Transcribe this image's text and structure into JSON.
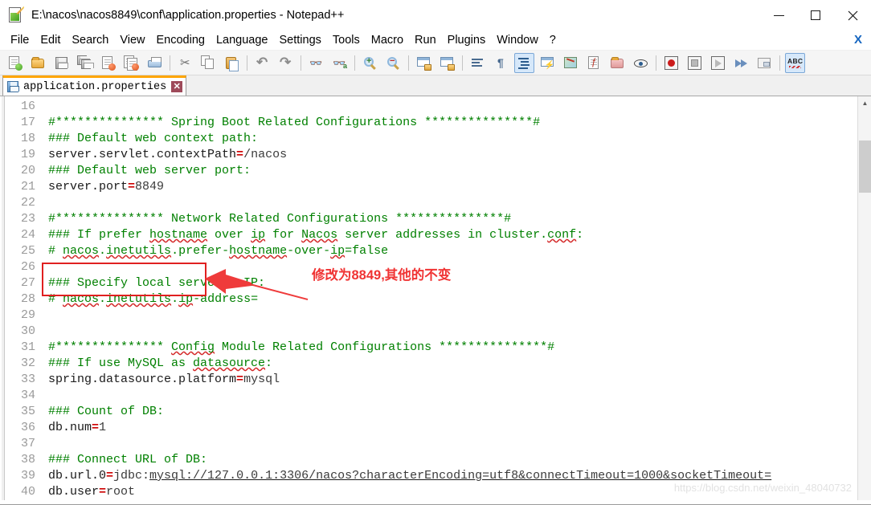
{
  "window": {
    "title": "E:\\nacos\\nacos8849\\conf\\application.properties - Notepad++",
    "icon": "notepad-plus-plus-icon",
    "minimize_label": "–",
    "maximize_label": "□",
    "close_label": "✕"
  },
  "menu": {
    "items": [
      {
        "label": "File"
      },
      {
        "label": "Edit"
      },
      {
        "label": "Search"
      },
      {
        "label": "View"
      },
      {
        "label": "Encoding"
      },
      {
        "label": "Language"
      },
      {
        "label": "Settings"
      },
      {
        "label": "Tools"
      },
      {
        "label": "Macro"
      },
      {
        "label": "Run"
      },
      {
        "label": "Plugins"
      },
      {
        "label": "Window"
      },
      {
        "label": "?"
      }
    ],
    "close_document_label": "X"
  },
  "toolbar": {
    "buttons": [
      {
        "name": "new-file-icon",
        "tooltip": "New"
      },
      {
        "name": "open-file-icon",
        "tooltip": "Open"
      },
      {
        "name": "save-icon",
        "tooltip": "Save"
      },
      {
        "name": "save-all-icon",
        "tooltip": "Save All"
      },
      {
        "name": "close-file-icon",
        "tooltip": "Close"
      },
      {
        "name": "close-all-files-icon",
        "tooltip": "Close All"
      },
      {
        "name": "print-icon",
        "tooltip": "Print"
      },
      {
        "name": "cut-icon",
        "tooltip": "Cut"
      },
      {
        "name": "copy-icon",
        "tooltip": "Copy"
      },
      {
        "name": "paste-icon",
        "tooltip": "Paste"
      },
      {
        "name": "undo-icon",
        "tooltip": "Undo"
      },
      {
        "name": "redo-icon",
        "tooltip": "Redo"
      },
      {
        "name": "find-icon",
        "tooltip": "Find"
      },
      {
        "name": "replace-icon",
        "tooltip": "Replace"
      },
      {
        "name": "zoom-in-icon",
        "tooltip": "Zoom In"
      },
      {
        "name": "zoom-out-icon",
        "tooltip": "Zoom Out"
      },
      {
        "name": "sync-vertical-scroll-icon",
        "tooltip": "Synchronize Vertical Scrolling"
      },
      {
        "name": "sync-horizontal-scroll-icon",
        "tooltip": "Synchronize Horizontal Scrolling"
      },
      {
        "name": "word-wrap-icon",
        "tooltip": "Word wrap"
      },
      {
        "name": "show-all-characters-icon",
        "tooltip": "Show All Characters"
      },
      {
        "name": "indent-guide-icon",
        "tooltip": "Show Indent Guide",
        "active": true
      },
      {
        "name": "user-defined-dialog-icon",
        "tooltip": "User-Defined Dialogue"
      },
      {
        "name": "document-map-icon",
        "tooltip": "Document Map"
      },
      {
        "name": "function-list-icon",
        "tooltip": "Function List"
      },
      {
        "name": "folder-as-workspace-icon",
        "tooltip": "Folder as Workspace"
      },
      {
        "name": "monitoring-icon",
        "tooltip": "Monitoring"
      },
      {
        "name": "record-macro-icon",
        "tooltip": "Start Recording"
      },
      {
        "name": "stop-recording-icon",
        "tooltip": "Stop Recording"
      },
      {
        "name": "play-macro-icon",
        "tooltip": "Playback"
      },
      {
        "name": "run-macro-multiple-icon",
        "tooltip": "Run a Macro Multiple Times"
      },
      {
        "name": "save-macro-icon",
        "tooltip": "Save Currently Recorded Macro"
      },
      {
        "name": "spell-check-icon",
        "tooltip": "Spell Check",
        "label": "ABC",
        "active": true
      }
    ]
  },
  "tabs": [
    {
      "label": "application.properties",
      "active": true,
      "close_label": "✕",
      "icon": "saved-file-icon"
    }
  ],
  "editor": {
    "first_line": 16,
    "lines": [
      {
        "n": 16,
        "segments": []
      },
      {
        "n": 17,
        "segments": [
          {
            "t": "#*************** Spring Boot Related Configurations ***************#",
            "c": "cmt"
          }
        ]
      },
      {
        "n": 18,
        "segments": [
          {
            "t": "### Default web context path:",
            "c": "cmt"
          }
        ]
      },
      {
        "n": 19,
        "segments": [
          {
            "t": "server.servlet.contextPath",
            "c": "key"
          },
          {
            "t": "=",
            "c": "eq"
          },
          {
            "t": "/nacos",
            "c": "val"
          }
        ]
      },
      {
        "n": 20,
        "segments": [
          {
            "t": "### Default web server port:",
            "c": "cmt"
          }
        ]
      },
      {
        "n": 21,
        "segments": [
          {
            "t": "server.port",
            "c": "key"
          },
          {
            "t": "=",
            "c": "eq"
          },
          {
            "t": "8849",
            "c": "val"
          }
        ]
      },
      {
        "n": 22,
        "segments": []
      },
      {
        "n": 23,
        "segments": [
          {
            "t": "#*************** Network Related Configurations ***************#",
            "c": "cmt"
          }
        ]
      },
      {
        "n": 24,
        "segments": [
          {
            "t": "### If prefer ",
            "c": "cmt"
          },
          {
            "t": "hostname",
            "c": "cmt sp"
          },
          {
            "t": " over ",
            "c": "cmt"
          },
          {
            "t": "ip",
            "c": "cmt sp"
          },
          {
            "t": " for ",
            "c": "cmt"
          },
          {
            "t": "Nacos",
            "c": "cmt sp"
          },
          {
            "t": " server addresses in cluster.",
            "c": "cmt"
          },
          {
            "t": "conf",
            "c": "cmt sp"
          },
          {
            "t": ":",
            "c": "cmt"
          }
        ]
      },
      {
        "n": 25,
        "segments": [
          {
            "t": "# ",
            "c": "cmt"
          },
          {
            "t": "nacos",
            "c": "cmt sp"
          },
          {
            "t": ".",
            "c": "cmt"
          },
          {
            "t": "inetutils",
            "c": "cmt sp"
          },
          {
            "t": ".prefer-",
            "c": "cmt"
          },
          {
            "t": "hostname",
            "c": "cmt sp"
          },
          {
            "t": "-over-",
            "c": "cmt"
          },
          {
            "t": "ip",
            "c": "cmt sp"
          },
          {
            "t": "=false",
            "c": "cmt"
          }
        ]
      },
      {
        "n": 26,
        "segments": []
      },
      {
        "n": 27,
        "segments": [
          {
            "t": "### Specify local server's IP:",
            "c": "cmt"
          }
        ]
      },
      {
        "n": 28,
        "segments": [
          {
            "t": "# ",
            "c": "cmt"
          },
          {
            "t": "nacos",
            "c": "cmt sp"
          },
          {
            "t": ".",
            "c": "cmt"
          },
          {
            "t": "inetutils",
            "c": "cmt sp"
          },
          {
            "t": ".",
            "c": "cmt"
          },
          {
            "t": "ip",
            "c": "cmt sp"
          },
          {
            "t": "-address=",
            "c": "cmt"
          }
        ]
      },
      {
        "n": 29,
        "segments": []
      },
      {
        "n": 30,
        "segments": []
      },
      {
        "n": 31,
        "segments": [
          {
            "t": "#*************** ",
            "c": "cmt"
          },
          {
            "t": "Config",
            "c": "cmt sp"
          },
          {
            "t": " Module Related Configurations ***************#",
            "c": "cmt"
          }
        ]
      },
      {
        "n": 32,
        "segments": [
          {
            "t": "### If use MySQL as ",
            "c": "cmt"
          },
          {
            "t": "datasource",
            "c": "cmt sp"
          },
          {
            "t": ":",
            "c": "cmt"
          }
        ]
      },
      {
        "n": 33,
        "segments": [
          {
            "t": "spring.datasource.platform",
            "c": "key"
          },
          {
            "t": "=",
            "c": "eq"
          },
          {
            "t": "mysql",
            "c": "val"
          }
        ]
      },
      {
        "n": 34,
        "segments": []
      },
      {
        "n": 35,
        "segments": [
          {
            "t": "### Count of DB:",
            "c": "cmt"
          }
        ]
      },
      {
        "n": 36,
        "segments": [
          {
            "t": "db.num",
            "c": "key"
          },
          {
            "t": "=",
            "c": "eq"
          },
          {
            "t": "1",
            "c": "val"
          }
        ]
      },
      {
        "n": 37,
        "segments": []
      },
      {
        "n": 38,
        "segments": [
          {
            "t": "### Connect URL of DB:",
            "c": "cmt"
          }
        ]
      },
      {
        "n": 39,
        "segments": [
          {
            "t": "db.url.0",
            "c": "key"
          },
          {
            "t": "=",
            "c": "eq"
          },
          {
            "t": "jdbc:",
            "c": "val"
          },
          {
            "t": "mysql://127.0.0.1:3306/nacos?characterEncoding=utf8&connectTimeout=1000&socketTimeout=",
            "c": "val url-link"
          }
        ]
      },
      {
        "n": 40,
        "segments": [
          {
            "t": "db.user",
            "c": "key"
          },
          {
            "t": "=",
            "c": "eq"
          },
          {
            "t": "root",
            "c": "val"
          }
        ]
      }
    ],
    "scrollbar": {
      "up_arrow": "▲",
      "down_arrow": "▼"
    }
  },
  "annotations": {
    "highlight_box": {
      "name": "red-highlight-rectangle",
      "color": "#e02020"
    },
    "arrow": {
      "name": "red-annotation-arrow",
      "color": "#ef3b3b"
    },
    "note_text": "修改为8849,其他的不变",
    "note_color": "#f03333"
  },
  "watermark": {
    "text": "https://blog.csdn.net/weixin_48040732"
  }
}
